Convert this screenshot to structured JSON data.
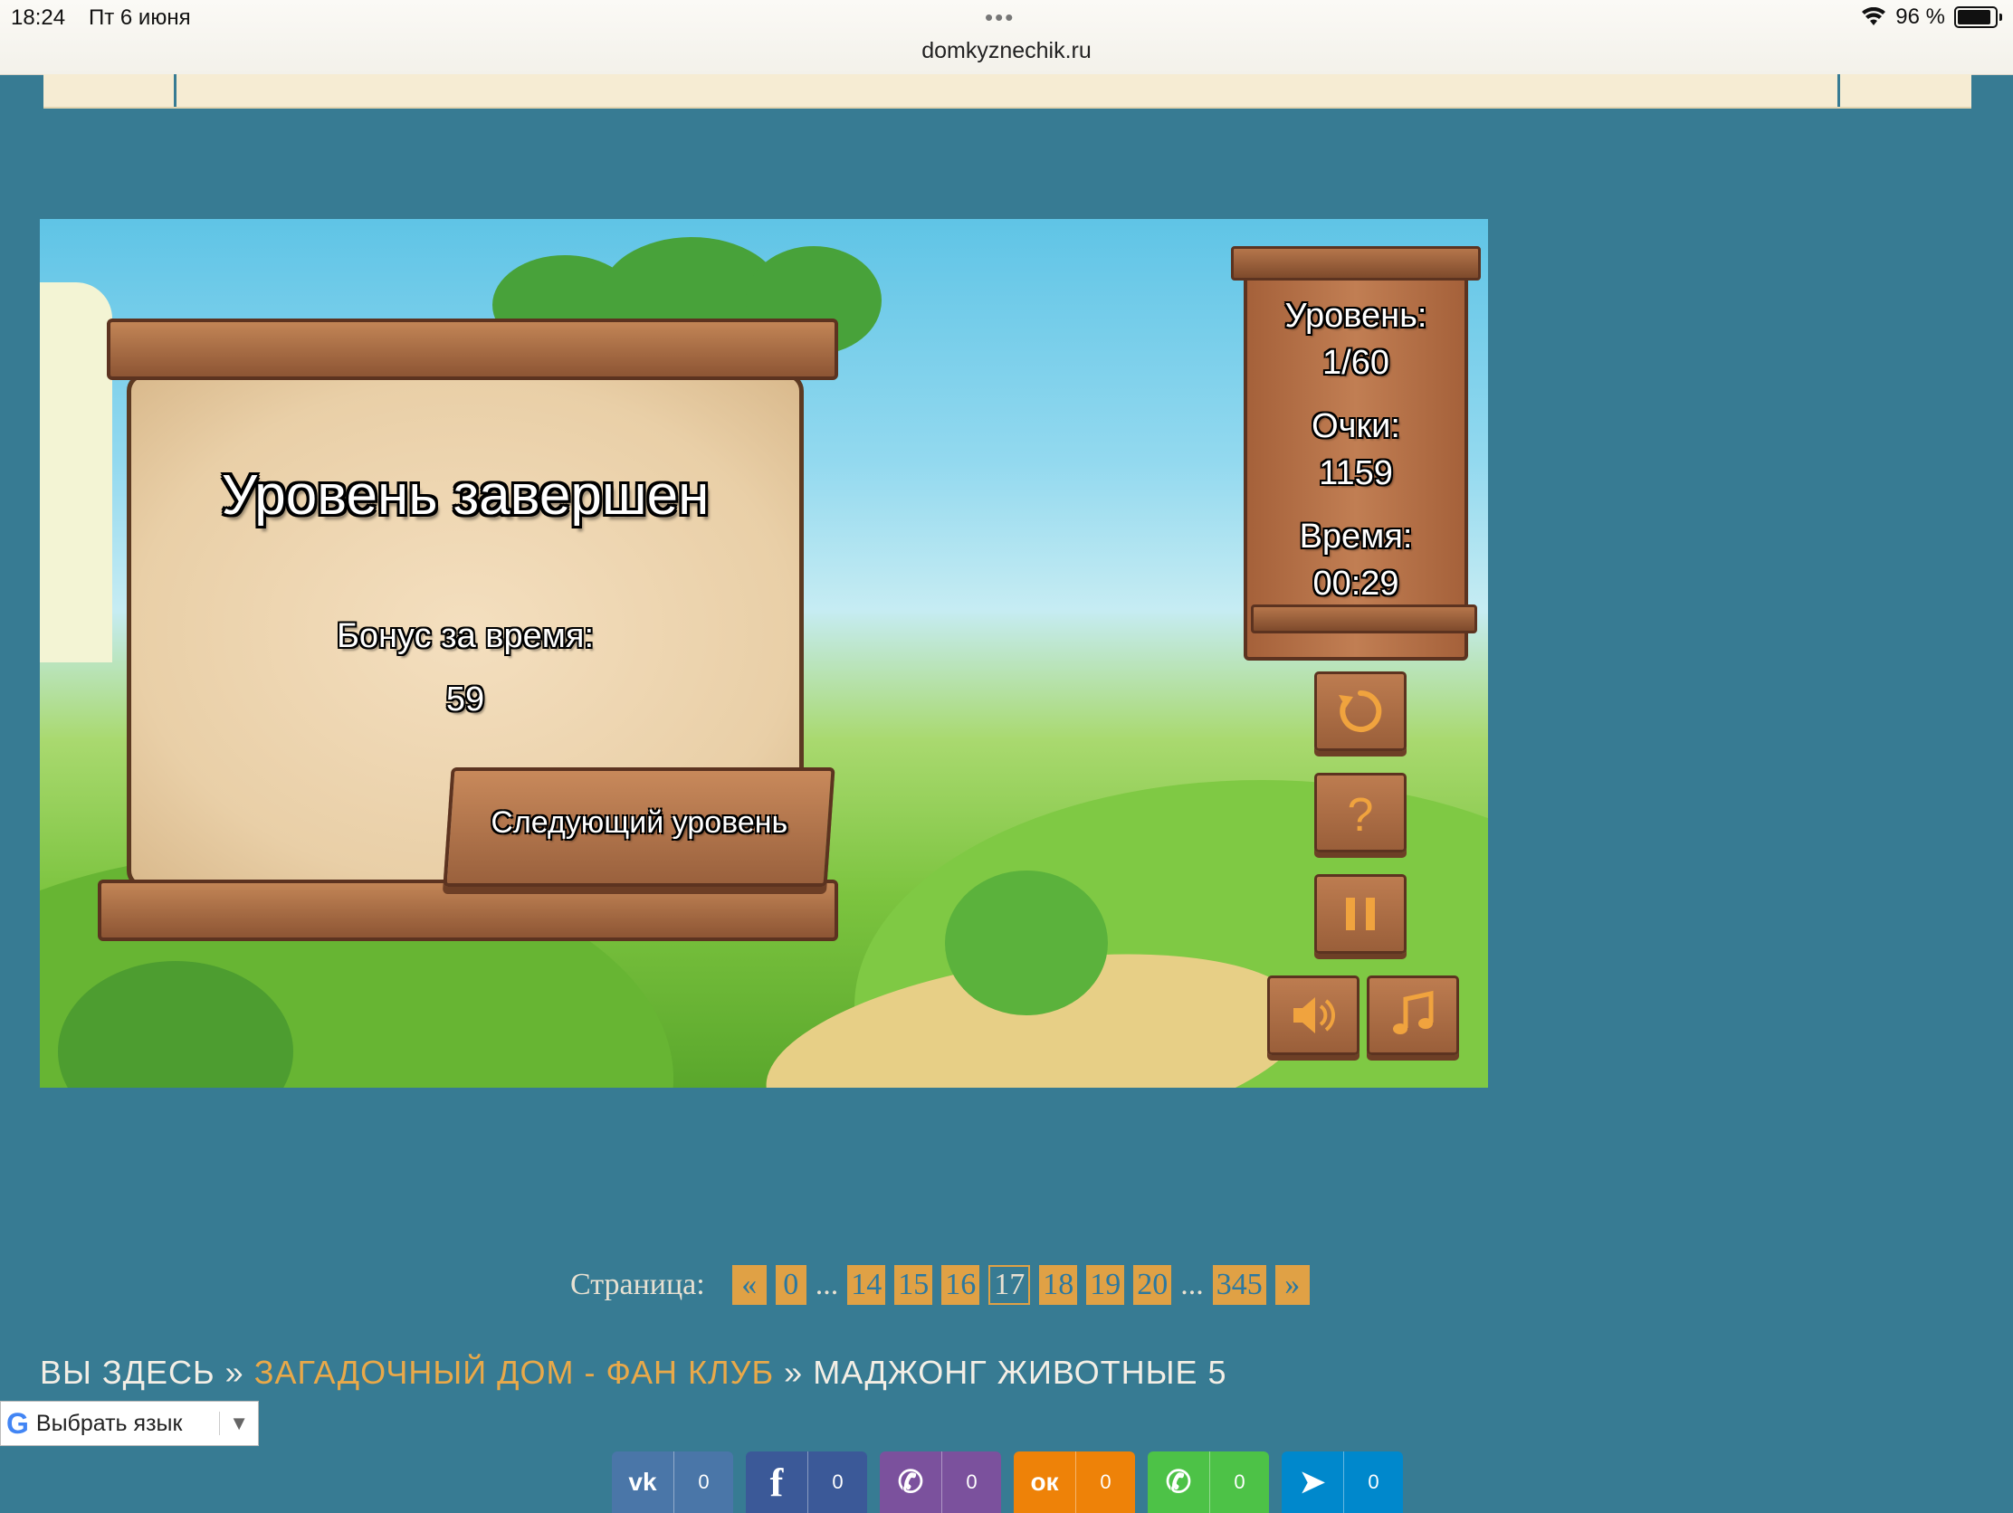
{
  "status": {
    "time": "18:24",
    "date": "Пт 6 июня",
    "battery": "96 %",
    "dots": "•••"
  },
  "browser": {
    "url": "domkyznechik.ru"
  },
  "game": {
    "title": "Уровень завершен",
    "bonus_label": "Бонус за время:",
    "bonus_value": "59",
    "next_button": "Следующий уровень",
    "level_label": "Уровень:",
    "level_value": "1/60",
    "score_label": "Очки:",
    "score_value": "1159",
    "time_label": "Время:",
    "time_value": "00:29",
    "controls": [
      "restart-icon",
      "help-icon",
      "pause-icon",
      "sound-icon",
      "music-icon"
    ],
    "accent_color": "#f0a33e"
  },
  "pagination": {
    "label": "Страница:",
    "prev": "«",
    "next": "»",
    "first": "0",
    "ellipsis": "...",
    "pages": [
      "14",
      "15",
      "16",
      "17",
      "18",
      "19",
      "20"
    ],
    "current": "17",
    "last": "345"
  },
  "breadcrumb": {
    "prefix": "ВЫ ЗДЕСЬ",
    "sep": "»",
    "parent": "ЗАГАДОЧНЫЙ ДОМ - ФАН КЛУБ",
    "current": "МАДЖОНГ ЖИВОТНЫЕ 5"
  },
  "translate": {
    "label": "Выбрать язык",
    "caret": "▼",
    "logo": "G"
  },
  "share": [
    {
      "network": "vk",
      "glyph": "vk",
      "count": "0",
      "color": "#4a76a8"
    },
    {
      "network": "facebook",
      "glyph": "f",
      "count": "0",
      "color": "#3b5998"
    },
    {
      "network": "viber",
      "glyph": "✆",
      "count": "0",
      "color": "#7b519d"
    },
    {
      "network": "odnoklassniki",
      "glyph": "ок",
      "count": "0",
      "color": "#ee8208"
    },
    {
      "network": "whatsapp",
      "glyph": "✆",
      "count": "0",
      "color": "#4dc247"
    },
    {
      "network": "telegram",
      "glyph": "➤",
      "count": "0",
      "color": "#0088cc"
    }
  ]
}
